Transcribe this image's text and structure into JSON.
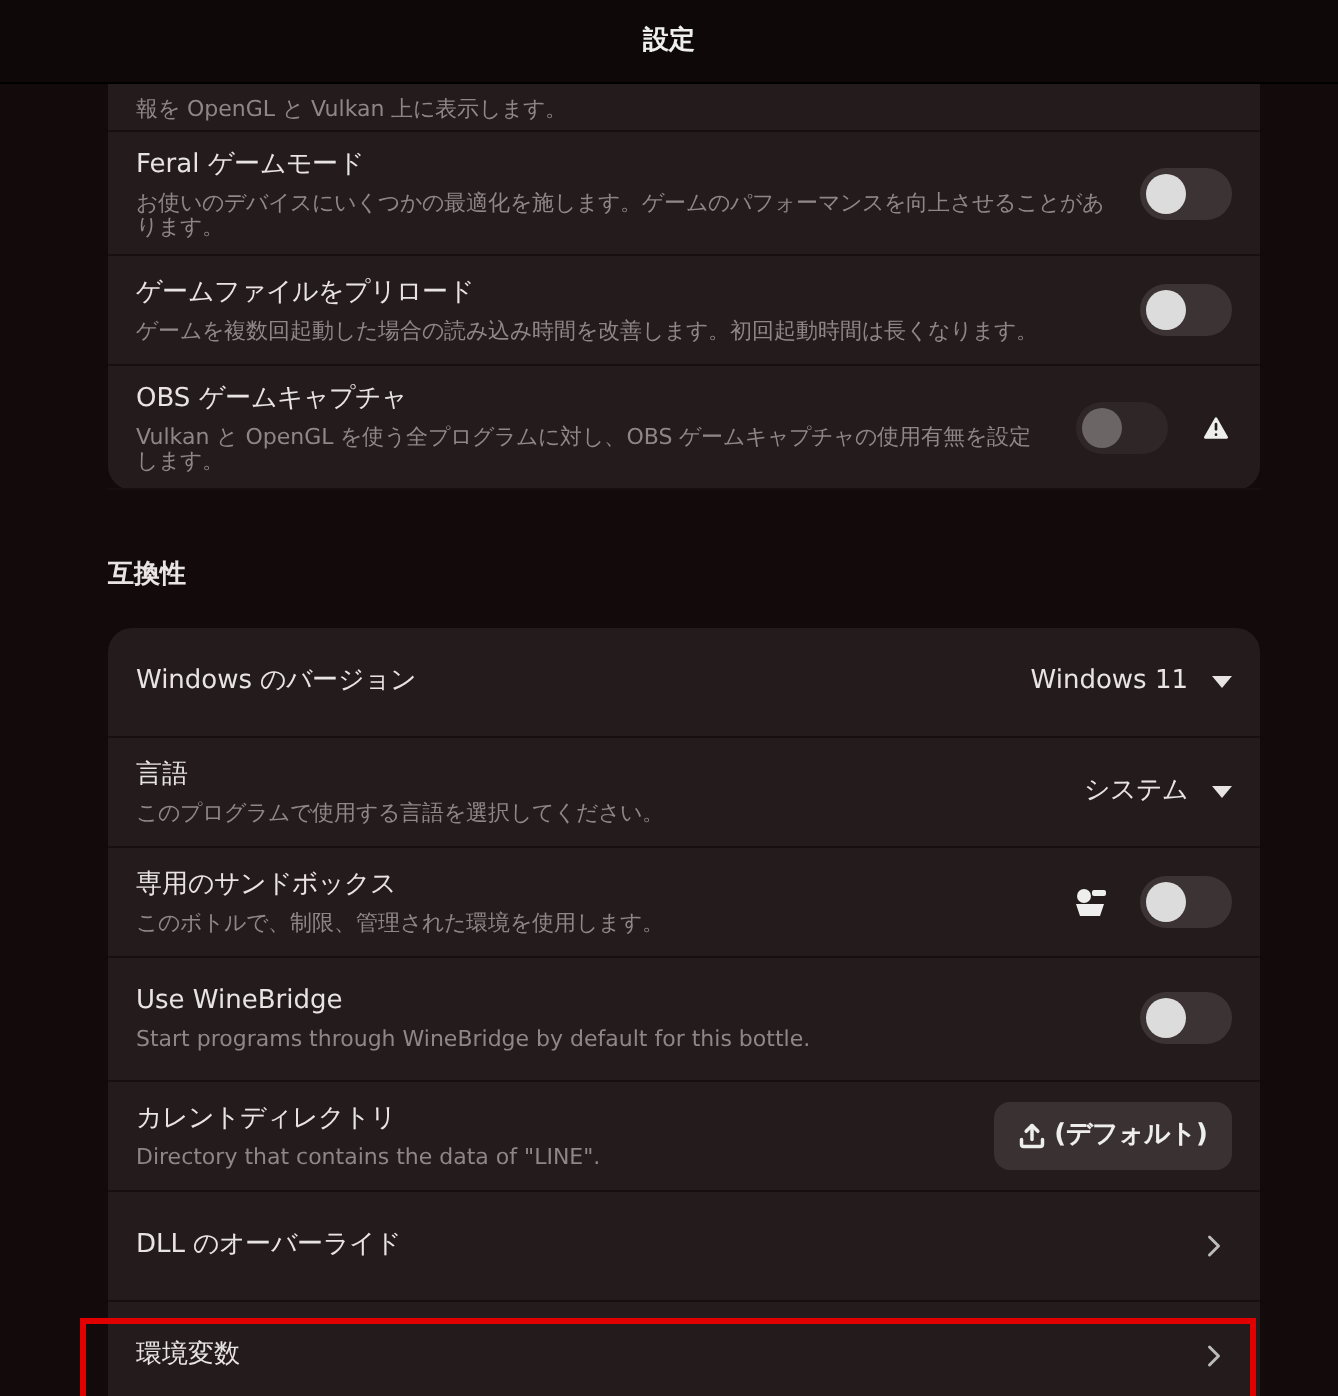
{
  "header": {
    "title": "設定"
  },
  "sections": [
    {
      "rows": [
        {
          "kind": "partial",
          "subtitle": "報を OpenGL と Vulkan 上に表示します。"
        },
        {
          "kind": "toggle",
          "title": "Feral ゲームモード",
          "subtitle": "お使いのデバイスにいくつかの最適化を施します。ゲームのパフォーマンスを向上させることがあります。",
          "on": false,
          "disabled": false
        },
        {
          "kind": "toggle",
          "title": "ゲームファイルをプリロード",
          "subtitle": "ゲームを複数回起動した場合の読み込み時間を改善します。初回起動時間は長くなります。",
          "on": false,
          "disabled": false
        },
        {
          "kind": "toggle",
          "title": "OBS ゲームキャプチャ",
          "subtitle": "Vulkan と OpenGL を使う全プログラムに対し、OBS ゲームキャプチャの使用有無を設定します。",
          "on": false,
          "disabled": true,
          "warning": true
        }
      ]
    },
    {
      "heading": "互換性",
      "rows": [
        {
          "kind": "dropdown",
          "title": "Windows のバージョン",
          "value": "Windows 11"
        },
        {
          "kind": "dropdown",
          "title": "言語",
          "subtitle": "このプログラムで使用する言語を選択してください。",
          "value": "システム"
        },
        {
          "kind": "toggle",
          "title": "専用のサンドボックス",
          "subtitle": "このボトルで、制限、管理された環境を使用します。",
          "on": false,
          "disabled": false,
          "settings": true
        },
        {
          "kind": "toggle",
          "title": "Use WineBridge",
          "subtitle": "Start programs through WineBridge by default for this bottle.",
          "on": false,
          "disabled": false
        },
        {
          "kind": "button",
          "title": "カレントディレクトリ",
          "subtitle": "Directory that contains the data of \"LINE\".",
          "value": "(デフォルト)"
        },
        {
          "kind": "link",
          "title": "DLL のオーバーライド"
        },
        {
          "kind": "link",
          "title": "環境変数",
          "highlighted": true
        }
      ]
    }
  ]
}
